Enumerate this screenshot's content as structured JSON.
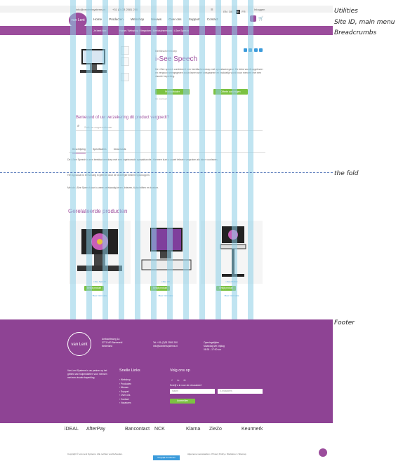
{
  "annotations": {
    "utilities": "Utilities",
    "site_id": "Site ID, main menu",
    "breadcrumbs": "Breadcrumbs",
    "fold": "the fold",
    "footer": "Footer"
  },
  "utility_bar": {
    "email": "info@vanlentsystems.nl",
    "phone": "+31 (0) 33 2581 250",
    "languages": [
      "EN",
      "DE",
      "NL",
      "FR"
    ],
    "account": "Inloggen"
  },
  "header": {
    "logo": "van Lent",
    "nav": [
      "Home",
      "Producten",
      "Webshop",
      "Nieuws",
      "Over ons",
      "Support",
      "Contact"
    ]
  },
  "breadcrumb": {
    "label": "Je bent hier:",
    "items": [
      "Home",
      "Webshop",
      "Vergroten",
      "Beeldschermloep",
      "i-See Speech"
    ]
  },
  "product": {
    "tag": "Beeldschermloep",
    "title": "i-See Speech",
    "description": "De i-See speech combineert een beeldschermloep met spraakweergave. De tekst wordt opgelezen en vergroot weergegeven zodat lezen weer ontspannen en makkelijk wordt voor mensen met een visuele beperking.",
    "btn_info": "Productfolder",
    "btn_quote": "Offerte aanvragen",
    "stock": "Op voorraad"
  },
  "insurance": {
    "title": "Benieuwd of uw verzekering dit product vergoedt?",
    "placeholder": "Zoek uw zorgverzekeraar"
  },
  "tabs": [
    "Beschrijving",
    "Specificaties",
    "Downloads"
  ],
  "tab_text": [
    "De i-See Speech is een beeldschermloep met een ingebouwde spraakfunctie. Hiermee kunt u zowel teksten vergroten als laten voorlezen.",
    "Het apparaat is eenvoudig in gebruik door de duidelijke bedieningsknoppen.",
    "Met de i-See Speech kunt u weer zelfstandig lezen, brieven, tijdschriften en boeken."
  ],
  "related": {
    "title": "Gerelateerde producten",
    "items": [
      {
        "name": "i-See Speech",
        "button": "Bekijk product",
        "link": "Meer informatie"
      },
      {
        "name": "i-See HD",
        "button": "Bekijk product",
        "link": "Meer informatie"
      },
      {
        "name": "i-See Mobiel",
        "button": "Bekijk product",
        "link": "Meer informatie"
      }
    ]
  },
  "footer": {
    "logo": "van Lent",
    "address": [
      "Ambachtsweg 1a",
      "3771 MG Barneveld",
      "Nederland"
    ],
    "contact": [
      "Tel: +31 (0)33 2581 250",
      "info@vanlentsystems.nl"
    ],
    "hours_title": "Openingstijden",
    "hours": [
      "Maandag t/m vrijdag",
      "08:30 - 17:00 uur"
    ],
    "about": "Van Lent Systems is uw partner op het gebied van hulpmiddelen voor mensen met een visuele beperking.",
    "links_title": "Snelle Links",
    "links": [
      "Webshop",
      "Producten",
      "Nieuws",
      "Support",
      "Over ons",
      "Contact",
      "Vacatures"
    ],
    "follow_title": "Volg ons op",
    "newsletter": "Schrijf u in voor de nieuwsbrief",
    "name_placeholder": "Naam",
    "email_placeholder": "E-mailadres",
    "subscribe": "Aanmelden"
  },
  "payments": [
    "iDEAL",
    "AfterPay",
    "Bancontact",
    "NCK",
    "Klarna",
    "ZieZo",
    "Keurmerk"
  ],
  "bottom": {
    "copyright": "Copyright © van Lent Systems. Alle rechten voorbehouden.",
    "legal": "Algemene voorwaarden  •  Privacy Policy  •  Disclaimer  •  Sitemap",
    "button": "Vergelijk Producten"
  }
}
